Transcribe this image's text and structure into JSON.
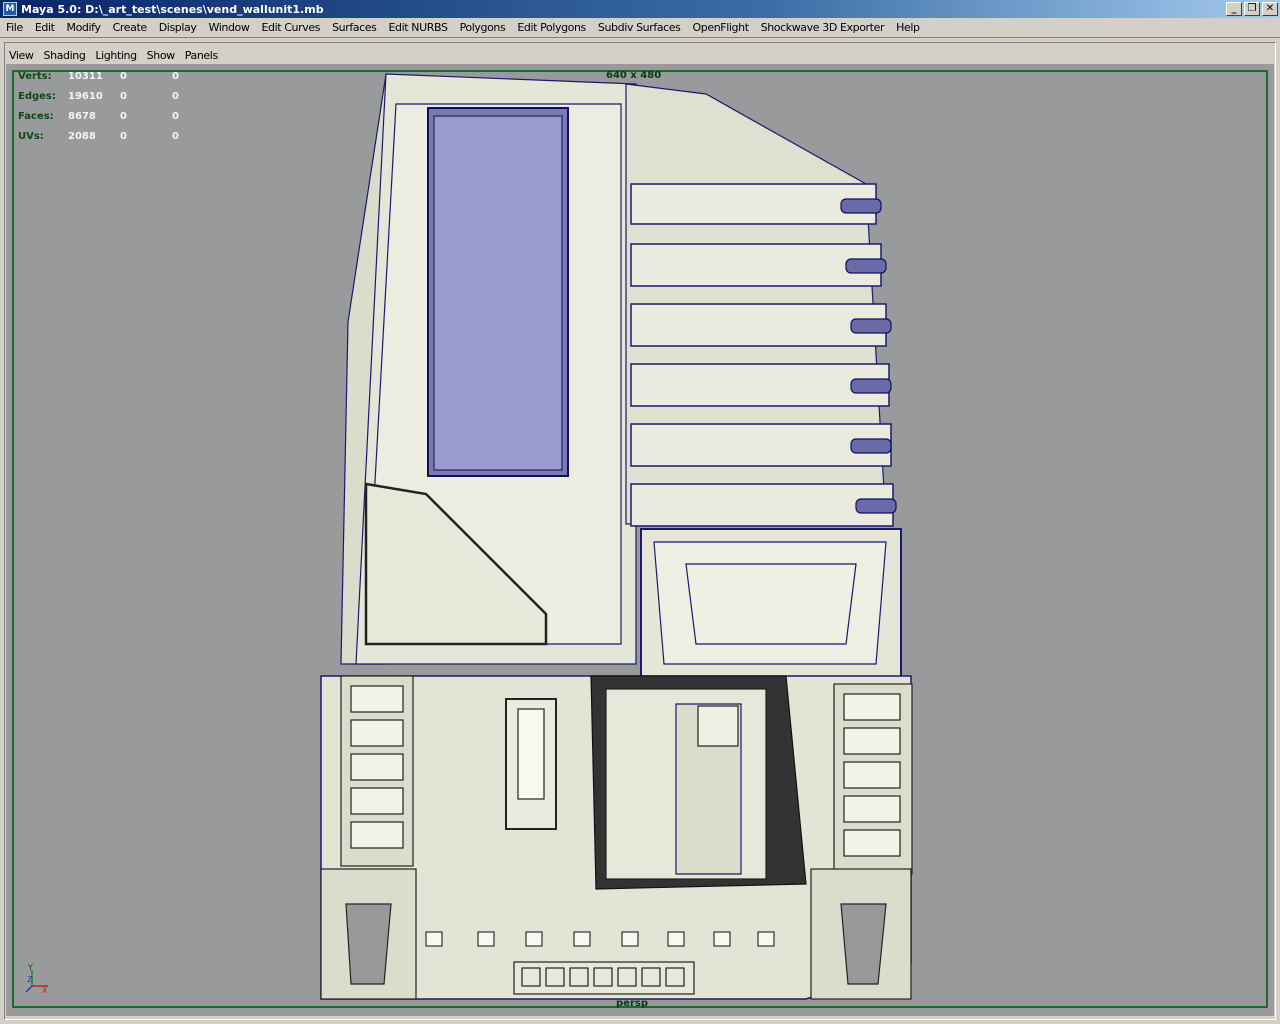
{
  "window": {
    "title": "Maya 5.0: D:\\_art_test\\scenes\\vend_wallunit1.mb",
    "buttons": {
      "minimize": "_",
      "restore": "❐",
      "close": "✕"
    }
  },
  "menubar": [
    "File",
    "Edit",
    "Modify",
    "Create",
    "Display",
    "Window",
    "Edit Curves",
    "Surfaces",
    "Edit NURBS",
    "Polygons",
    "Edit Polygons",
    "Subdiv Surfaces",
    "OpenFlight",
    "Shockwave 3D Exporter",
    "Help"
  ],
  "panel_menu": [
    "View",
    "Shading",
    "Lighting",
    "Show",
    "Panels"
  ],
  "hud": {
    "rows": [
      {
        "label": "Verts:",
        "v1": "10311",
        "v2": "0",
        "v3": "0"
      },
      {
        "label": "Edges:",
        "v1": "19610",
        "v2": "0",
        "v3": "0"
      },
      {
        "label": "Faces:",
        "v1": "8678",
        "v2": "0",
        "v3": "0"
      },
      {
        "label": "UVs:",
        "v1": "2088",
        "v2": "0",
        "v3": "0"
      }
    ],
    "resolution_gate": "640 x 480",
    "camera_name": "persp"
  },
  "axis": {
    "y": "Y",
    "z": "Z",
    "x": "X"
  },
  "colors": {
    "viewport_bg": "#999a9c",
    "model_fill": "#e8e8da",
    "wire": "#1a1a6e",
    "hud_green": "#1d6b2a"
  }
}
